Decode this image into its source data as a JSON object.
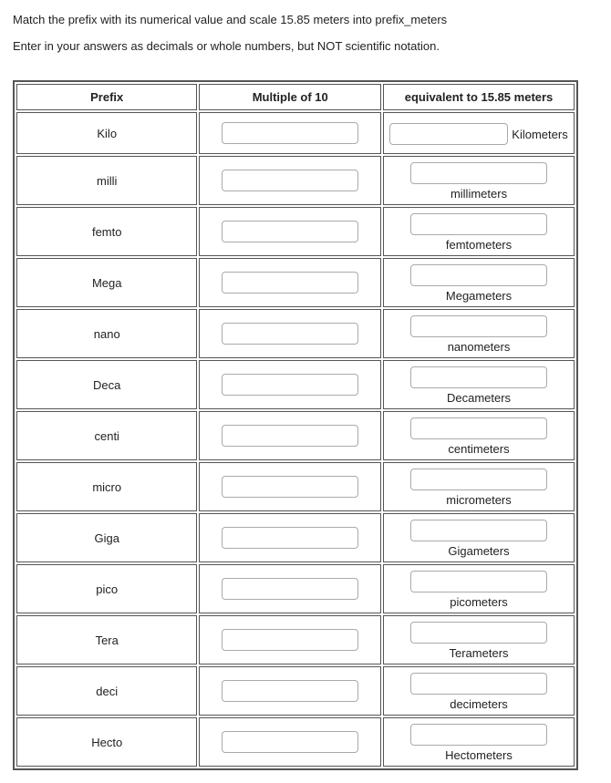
{
  "intro": {
    "line1": "Match the prefix with its numerical value and scale 15.85 meters into prefix_meters",
    "line2": "Enter in your answers as decimals or whole numbers, but NOT scientific notation."
  },
  "headers": {
    "col1": "Prefix",
    "col2": "Multiple of 10",
    "col3": "equivalent to 15.85 meters"
  },
  "rows": [
    {
      "prefix": "Kilo",
      "unit": "Kilometers",
      "side": true
    },
    {
      "prefix": "milli",
      "unit": "millimeters",
      "side": false
    },
    {
      "prefix": "femto",
      "unit": "femtometers",
      "side": false
    },
    {
      "prefix": "Mega",
      "unit": "Megameters",
      "side": false
    },
    {
      "prefix": "nano",
      "unit": "nanometers",
      "side": false
    },
    {
      "prefix": "Deca",
      "unit": "Decameters",
      "side": false
    },
    {
      "prefix": "centi",
      "unit": "centimeters",
      "side": false
    },
    {
      "prefix": "micro",
      "unit": "micrometers",
      "side": false
    },
    {
      "prefix": "Giga",
      "unit": "Gigameters",
      "side": false
    },
    {
      "prefix": "pico",
      "unit": "picometers",
      "side": false
    },
    {
      "prefix": "Tera",
      "unit": "Terameters",
      "side": false
    },
    {
      "prefix": "deci",
      "unit": "decimeters",
      "side": false
    },
    {
      "prefix": "Hecto",
      "unit": "Hectometers",
      "side": false
    }
  ]
}
